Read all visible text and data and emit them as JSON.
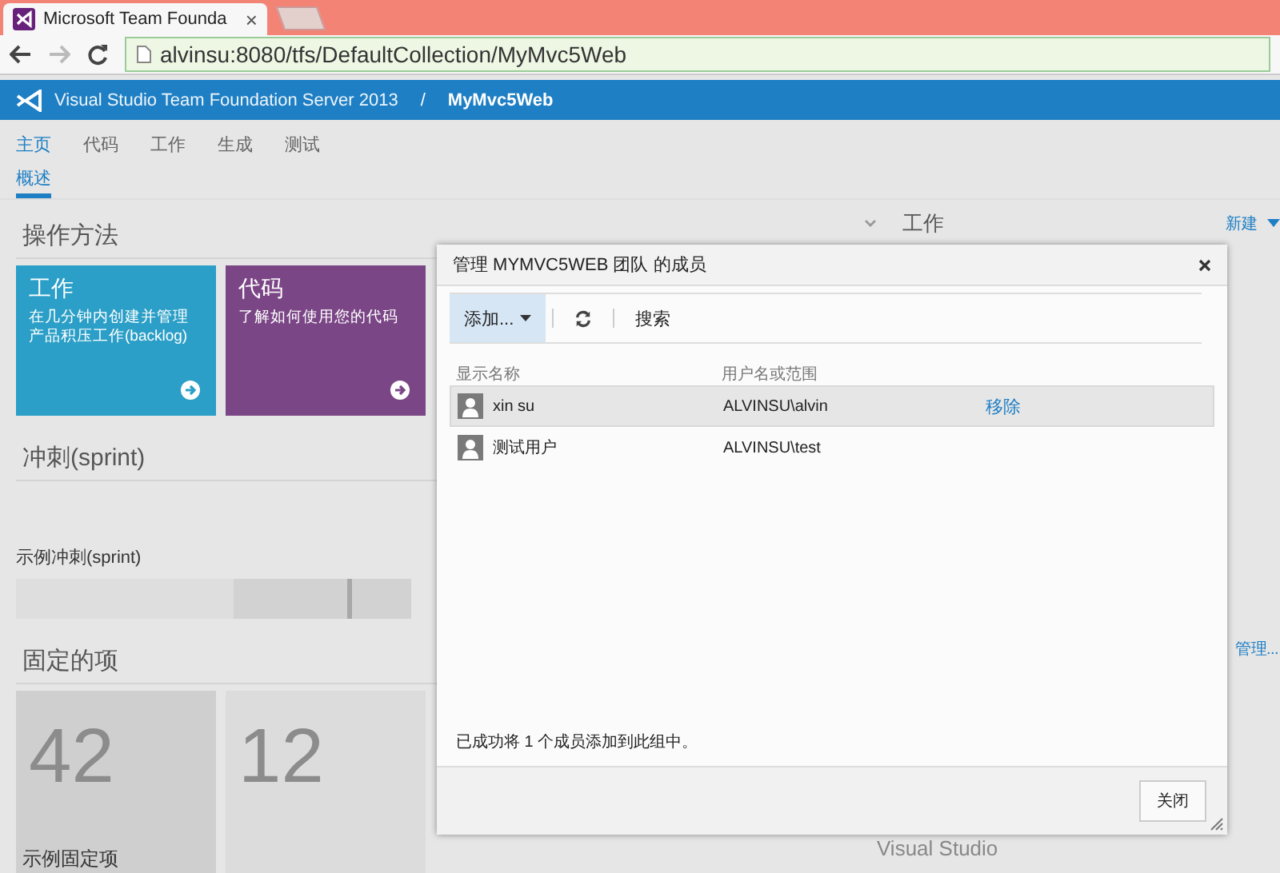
{
  "browser": {
    "tab_title": "Microsoft Team Founda",
    "tab_close": "×",
    "address": "alvinsu:8080/tfs/DefaultCollection/MyMvc5Web"
  },
  "header": {
    "product": "Visual Studio Team Foundation Server 2013",
    "separator": "/",
    "project": "MyMvc5Web"
  },
  "nav": [
    {
      "label": "主页",
      "selected": true
    },
    {
      "label": "代码",
      "selected": false
    },
    {
      "label": "工作",
      "selected": false
    },
    {
      "label": "生成",
      "selected": false
    },
    {
      "label": "测试",
      "selected": false
    }
  ],
  "subnav": [
    {
      "label": "概述",
      "selected": true
    }
  ],
  "getting_started": {
    "title": "操作方法",
    "tiles": [
      {
        "title": "工作",
        "text": "在几分钟内创建并管理产品积压工作(backlog)",
        "color": "#2b9fc7"
      },
      {
        "title": "代码",
        "text": "了解如何使用您的代码",
        "color": "#7b4686"
      }
    ]
  },
  "sprint": {
    "title": "冲刺(sprint)",
    "name": "示例冲刺(sprint)",
    "level": 0.84
  },
  "pinned": {
    "title": "固定的项",
    "tiles": [
      {
        "count": "42",
        "label": "示例固定项"
      },
      {
        "count": "12"
      }
    ]
  },
  "work_panel": {
    "title": "工作",
    "new": "新建",
    "manage": "管理...",
    "footer": "Visual Studio"
  },
  "dialog": {
    "title": "管理 MYMVC5WEB 团队 的成员",
    "toolbar": [
      {
        "kind": "menu",
        "label": "添加...",
        "selected": true
      },
      {
        "kind": "refresh",
        "selected": false
      },
      {
        "kind": "text",
        "label": "搜索",
        "selected": false
      }
    ],
    "columns": [
      "显示名称",
      "用户名或范围"
    ],
    "rows": [
      {
        "name": "xin su",
        "account": "ALVINSU\\alvin",
        "action": "移除",
        "selected": true
      },
      {
        "name": "测试用户",
        "account": "ALVINSU\\test",
        "selected": false
      }
    ],
    "status": "已成功将 1 个成员添加到此组中。",
    "close": "关闭"
  }
}
